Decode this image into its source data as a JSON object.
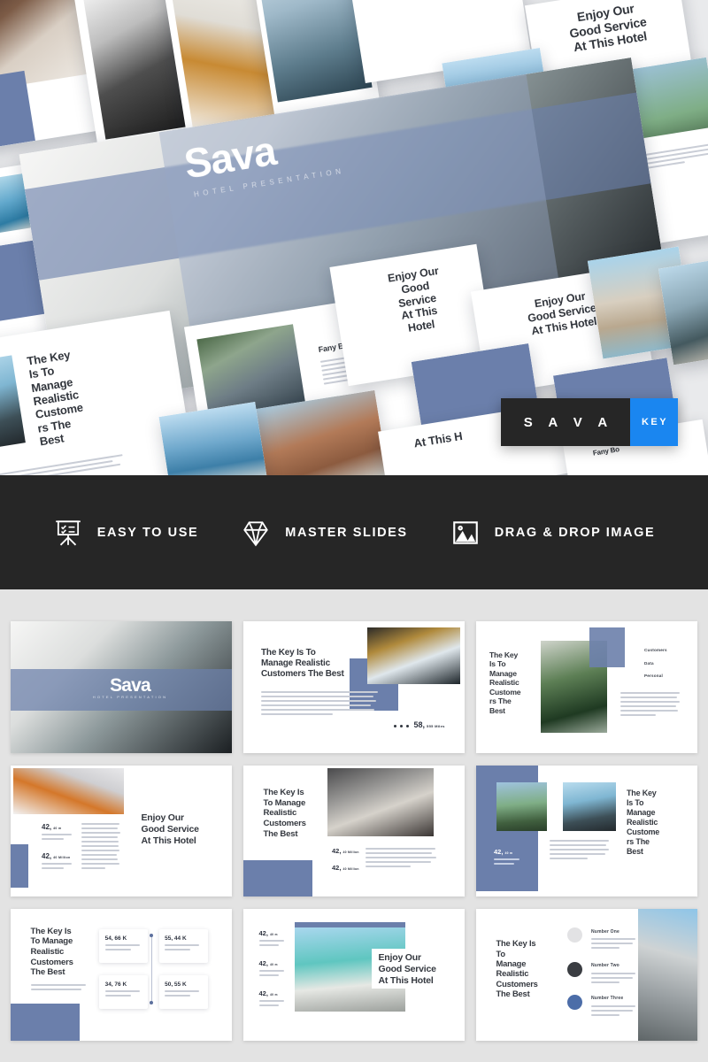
{
  "hero": {
    "title": "Sava",
    "subtitle": "HOTEL PRESENTATION",
    "badge": {
      "brand": "S A V A",
      "key": "KEY"
    },
    "slide_texts": {
      "enjoy": "Enjoy Our\nGood Service\nAt This Hotel",
      "key_long": "The Key\nIs To\nManage\nRealistic\nCustome\nrs The\nBest",
      "author": "Fany Bo",
      "enjoy_tall": "Enjoy Our\nGood\nService\nAt This\nHotel",
      "at_this": "At This H"
    }
  },
  "features": [
    {
      "icon": "presentation-board-icon",
      "label": "EASY TO USE"
    },
    {
      "icon": "diamond-icon",
      "label": "MASTER SLIDES"
    },
    {
      "icon": "image-placeholder-icon",
      "label": "DRAG & DROP IMAGE"
    }
  ],
  "slides": [
    {
      "id": "slide-cover",
      "name": "cover-slide",
      "title": "Sava",
      "subtitle": "HOTEL PRESENTATION"
    },
    {
      "id": "slide-key-image-right",
      "name": "key-image-right-slide",
      "title": "The Key Is To\nManage Realistic\nCustomers The Best",
      "stat": "58,",
      "stat_unit": "555 Miles"
    },
    {
      "id": "slide-three-labels",
      "name": "three-labels-slide",
      "title": "The Key\nIs To\nManage\nRealistic\nCustome\nrs The\nBest",
      "labels": [
        "Customers",
        "Data",
        "Personal"
      ]
    },
    {
      "id": "slide-enjoy-stats",
      "name": "enjoy-stats-slide",
      "title": "Enjoy Our\nGood Service\nAt This Hotel",
      "stats": [
        {
          "value": "42,",
          "unit": "40 m"
        },
        {
          "value": "42,",
          "unit": "40 Million"
        }
      ]
    },
    {
      "id": "slide-key-towels",
      "name": "key-towels-slide",
      "title": "The Key Is\nTo Manage\nRealistic\nCustomers\nThe Best",
      "stats": [
        {
          "value": "42,",
          "unit": "40 Million"
        },
        {
          "value": "42,",
          "unit": "40 Million"
        }
      ]
    },
    {
      "id": "slide-key-two-photos",
      "name": "key-two-photos-slide",
      "title": "The Key\nIs To\nManage\nRealistic\nCustome\nrs The\nBest",
      "stats": [
        {
          "value": "42,",
          "unit": "40 m"
        }
      ]
    },
    {
      "id": "slide-stat-cards",
      "name": "stat-cards-slide",
      "title": "The Key Is\nTo Manage\nRealistic\nCustomers\nThe Best",
      "cards": [
        {
          "value": "54, 66 K"
        },
        {
          "value": "55, 44 K"
        },
        {
          "value": "34, 76 K"
        },
        {
          "value": "50, 55 K"
        }
      ]
    },
    {
      "id": "slide-enjoy-building",
      "name": "enjoy-building-slide",
      "title": "Enjoy Our\nGood Service\nAt This Hotel",
      "stats": [
        {
          "value": "42,",
          "unit": "40 m"
        },
        {
          "value": "42,",
          "unit": "40 m"
        },
        {
          "value": "42,",
          "unit": "40 m"
        }
      ]
    },
    {
      "id": "slide-numbered-list",
      "name": "numbered-list-slide",
      "title": "The Key Is\nTo\nManage\nRealistic\nCustomers\nThe Best",
      "items": [
        "Number One",
        "Number Two",
        "Number Three"
      ]
    }
  ],
  "colors": {
    "periwinkle": "#6b7fab",
    "dark": "#262626",
    "blue_key": "#1a86f0",
    "grid_bg": "#e3e3e3",
    "hero_bg": "#e9eaec"
  }
}
